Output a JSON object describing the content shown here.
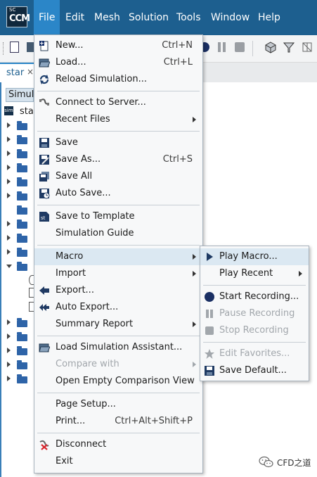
{
  "menubar": {
    "logo": {
      "top": "SC",
      "main": "CCM"
    },
    "items": [
      "File",
      "Edit",
      "Mesh",
      "Solution",
      "Tools",
      "Window",
      "Help"
    ]
  },
  "tab": {
    "label": "star",
    "close": "×"
  },
  "panel": {
    "header": "Simul",
    "root_label": "sta",
    "root_icon": "sim"
  },
  "file_menu": {
    "new": {
      "label": "New...",
      "shortcut": "Ctrl+N"
    },
    "load": {
      "label": "Load...",
      "shortcut": "Ctrl+L"
    },
    "reload": {
      "label": "Reload Simulation..."
    },
    "connect": {
      "label": "Connect to Server..."
    },
    "recent": {
      "label": "Recent Files"
    },
    "save": {
      "label": "Save"
    },
    "save_as": {
      "label": "Save As...",
      "shortcut": "Ctrl+S"
    },
    "save_all": {
      "label": "Save All"
    },
    "auto_save": {
      "label": "Auto Save..."
    },
    "save_template": {
      "label": "Save to Template"
    },
    "sim_guide": {
      "label": "Simulation Guide"
    },
    "macro": {
      "label": "Macro"
    },
    "import": {
      "label": "Import"
    },
    "export": {
      "label": "Export..."
    },
    "auto_export": {
      "label": "Auto Export..."
    },
    "summary": {
      "label": "Summary Report"
    },
    "load_assistant": {
      "label": "Load Simulation Assistant..."
    },
    "compare": {
      "label": "Compare with"
    },
    "open_empty": {
      "label": "Open Empty Comparison View"
    },
    "page_setup": {
      "label": "Page Setup..."
    },
    "print": {
      "label": "Print...",
      "shortcut": "Ctrl+Alt+Shift+P"
    },
    "disconnect": {
      "label": "Disconnect"
    },
    "exit": {
      "label": "Exit"
    }
  },
  "macro_menu": {
    "play_macro": {
      "label": "Play Macro..."
    },
    "play_recent": {
      "label": "Play Recent"
    },
    "start_recording": {
      "label": "Start Recording..."
    },
    "pause_recording": {
      "label": "Pause Recording"
    },
    "stop_recording": {
      "label": "Stop Recording"
    },
    "edit_favorites": {
      "label": "Edit Favorites..."
    },
    "save_default": {
      "label": "Save Default..."
    }
  },
  "watermark": {
    "text": "CFD之道"
  },
  "colors": {
    "menubar": "#1d5f8f",
    "active_menu": "#2b86c8",
    "highlight": "#dbe8f2",
    "disabled": "#a2a7ac"
  }
}
